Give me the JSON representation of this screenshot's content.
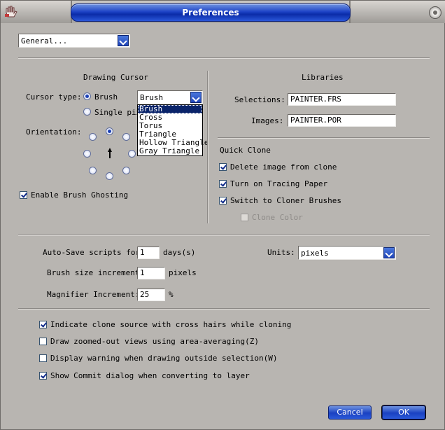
{
  "window": {
    "title": "Preferences"
  },
  "category_dropdown": {
    "value": "General..."
  },
  "drawing_cursor": {
    "heading": "Drawing Cursor",
    "cursor_type_label": "Cursor type:",
    "radio_brush": "Brush",
    "radio_single_pixel": "Single pix",
    "cursor_select_value": "Brush",
    "cursor_options": [
      "Brush",
      "Cross",
      "Torus",
      "Triangle",
      "Hollow Triangle",
      "Gray Triangle"
    ],
    "orientation_label": "Orientation:",
    "ghosting_label": "Enable Brush Ghosting",
    "ghosting_checked": true
  },
  "libraries": {
    "heading": "Libraries",
    "selections_label": "Selections:",
    "selections_value": "PAINTER.FRS",
    "images_label": "Images:",
    "images_value": "PAINTER.POR"
  },
  "quick_clone": {
    "heading": "Quick Clone",
    "options": [
      {
        "label": "Delete image from clone",
        "checked": true
      },
      {
        "label": "Turn on Tracing Paper",
        "checked": true
      },
      {
        "label": "Switch to Cloner Brushes",
        "checked": true
      }
    ],
    "clone_color_label": "Clone Color",
    "clone_color_checked": false
  },
  "settings": {
    "autosave_label": "Auto-Save scripts for",
    "autosave_value": "1",
    "autosave_unit": "days(s)",
    "units_label": "Units:",
    "units_value": "pixels",
    "brush_inc_label": "Brush size increment",
    "brush_inc_value": "1",
    "brush_inc_unit": "pixels",
    "magnifier_label": "Magnifier Increment:",
    "magnifier_value": "25",
    "magnifier_unit": "%"
  },
  "misc_options": [
    {
      "label": "Indicate clone source with cross hairs while cloning",
      "checked": true
    },
    {
      "label": "Draw zoomed-out views using area-averaging(Z)",
      "checked": false
    },
    {
      "label": "Display warning when drawing outside selection(W)",
      "checked": false
    },
    {
      "label": "Show Commit dialog when converting to layer",
      "checked": true
    }
  ],
  "buttons": {
    "cancel": "Cancel",
    "ok": "OK"
  }
}
